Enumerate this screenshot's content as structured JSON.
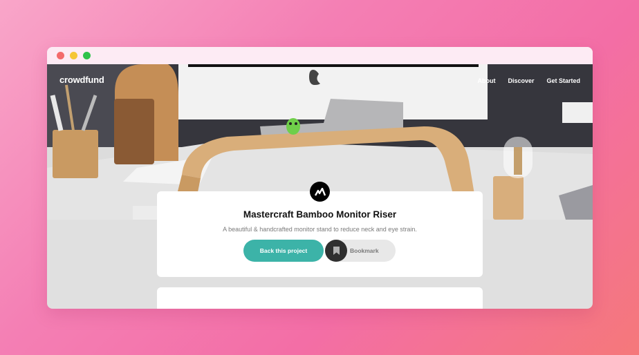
{
  "window": {
    "controls": [
      "close",
      "minimize",
      "maximize"
    ]
  },
  "header": {
    "brand": "crowdfund",
    "nav": [
      "About",
      "Discover",
      "Get Started"
    ]
  },
  "hero": {
    "image": "monitor-on-bamboo-riser-photo"
  },
  "project": {
    "logo_icon": "mastercraft-logo-icon",
    "title": "Mastercraft Bamboo Monitor Riser",
    "subtitle": "A beautiful & handcrafted monitor stand to reduce neck and eye strain.",
    "back_label": "Back this project",
    "bookmark_label": "Bookmark",
    "bookmark_icon": "bookmark-icon"
  },
  "colors": {
    "accent": "#3cb3a8",
    "bookmark_circle": "#2f2f2f",
    "page_bg": "#e0e0e0"
  }
}
